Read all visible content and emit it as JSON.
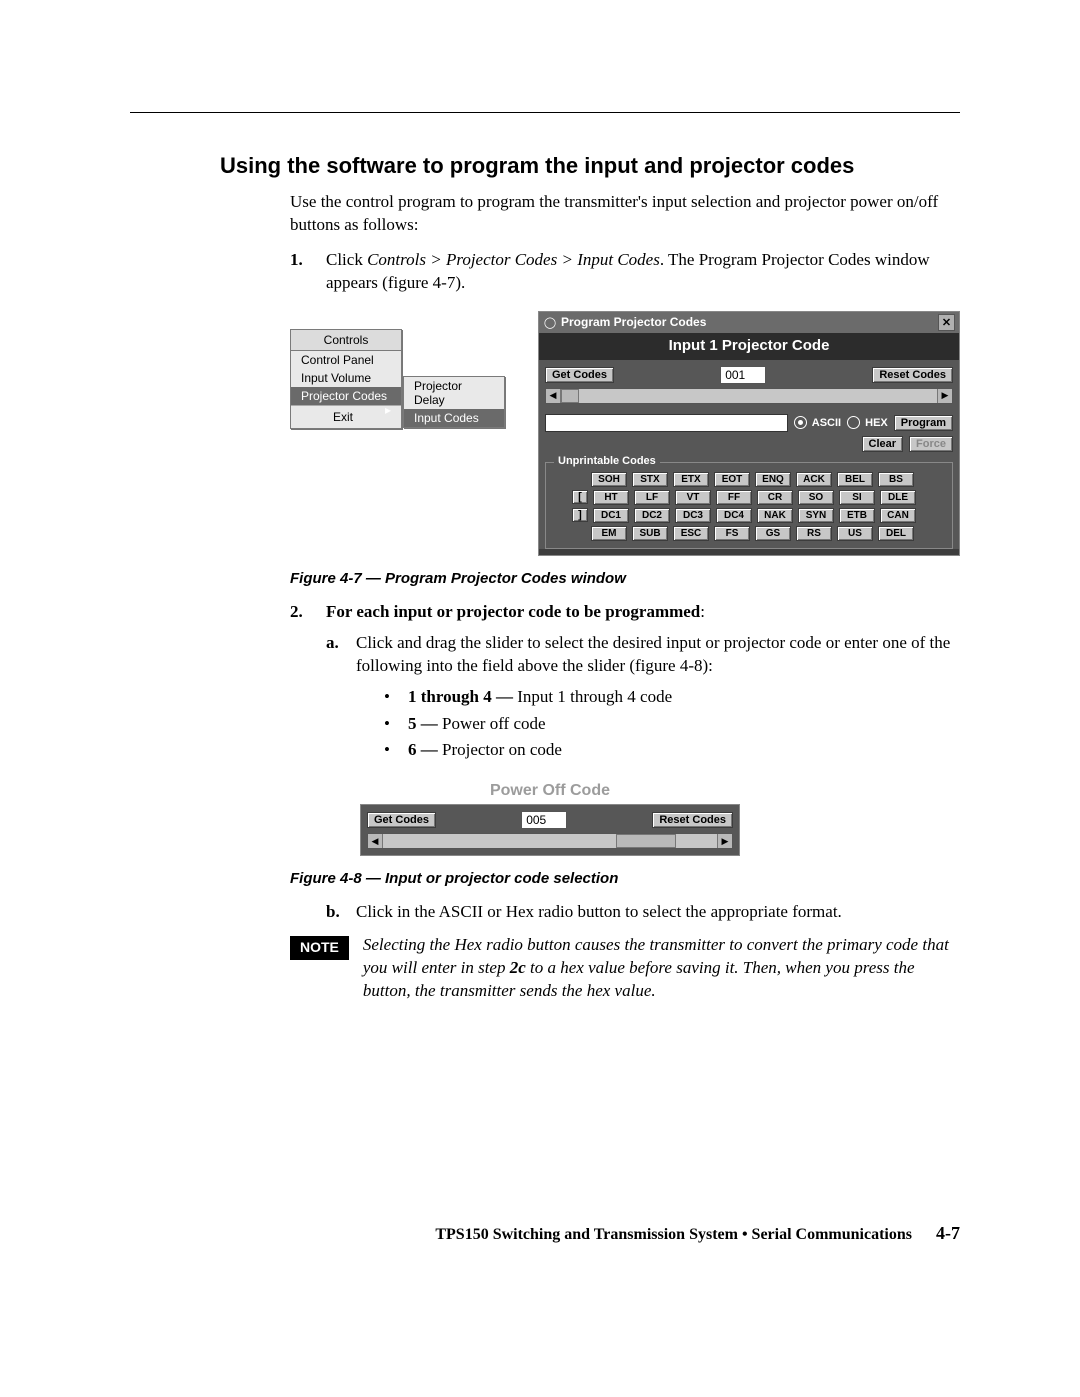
{
  "heading": "Using the software to program the input and projector codes",
  "intro": "Use the control program to program the transmitter's input selection and projector power on/off buttons as follows:",
  "step1_num": "1.",
  "step1_a": "Click ",
  "step1_path": "Controls > Projector Codes > Input Codes",
  "step1_b": ".  The Program Projector Codes window appears (figure 4-7).",
  "menu": {
    "title": "Controls",
    "items": [
      "Control Panel",
      "Input Volume",
      "Projector Codes",
      "Exit"
    ],
    "sub": [
      "Projector Delay",
      "Input Codes"
    ]
  },
  "win": {
    "title": "Program Projector Codes",
    "header": "Input 1 Projector Code",
    "get": "Get Codes",
    "reset": "Reset Codes",
    "value": "001",
    "ascii": "ASCII",
    "hex": "HEX",
    "program": "Program",
    "clear": "Clear",
    "force": "Force",
    "fieldset": "Unprintable Codes",
    "rows": [
      {
        "lead": "",
        "cells": [
          "SOH",
          "STX",
          "ETX",
          "EOT",
          "ENQ",
          "ACK",
          "BEL",
          "BS"
        ]
      },
      {
        "lead": "[",
        "cells": [
          "HT",
          "LF",
          "VT",
          "FF",
          "CR",
          "SO",
          "SI",
          "DLE"
        ]
      },
      {
        "lead": "]",
        "cells": [
          "DC1",
          "DC2",
          "DC3",
          "DC4",
          "NAK",
          "SYN",
          "ETB",
          "CAN"
        ]
      },
      {
        "lead": "",
        "cells": [
          "EM",
          "SUB",
          "ESC",
          "FS",
          "GS",
          "RS",
          "US",
          "DEL"
        ]
      }
    ]
  },
  "fig47_caption": "Figure 4-7 — Program Projector Codes window",
  "step2_num": "2.",
  "step2_text": "For each input or projector code to be programmed",
  "step2_colon": ":",
  "sub_a_id": "a.",
  "sub_a_text": "Click and drag the slider to select the desired input or projector code or enter one of the following into the field above the slider (figure 4-8):",
  "bullets": [
    {
      "k": "1 through 4 —",
      "v": " Input 1 through 4 code"
    },
    {
      "k": "5 —",
      "v": " Power off code"
    },
    {
      "k": "6 —",
      "v": " Projector on code"
    }
  ],
  "fig48": {
    "title": "Power Off Code",
    "get": "Get Codes",
    "value": "005",
    "reset": "Reset Codes"
  },
  "fig48_caption": "Figure 4-8 — Input or projector code selection",
  "sub_b_id": "b.",
  "sub_b_text": "Click in the ASCII or Hex radio button to select the appropriate format.",
  "note_label": "NOTE",
  "note_a": "Selecting the Hex radio button causes the transmitter to convert the primary code that you will enter in step ",
  "note_bold": "2c",
  "note_b": " to a hex value before saving it.  Then, when you press the button, the transmitter sends the hex value.",
  "footer_title": "TPS150 Switching and Transmission System • Serial Communications",
  "footer_page": "4-7"
}
